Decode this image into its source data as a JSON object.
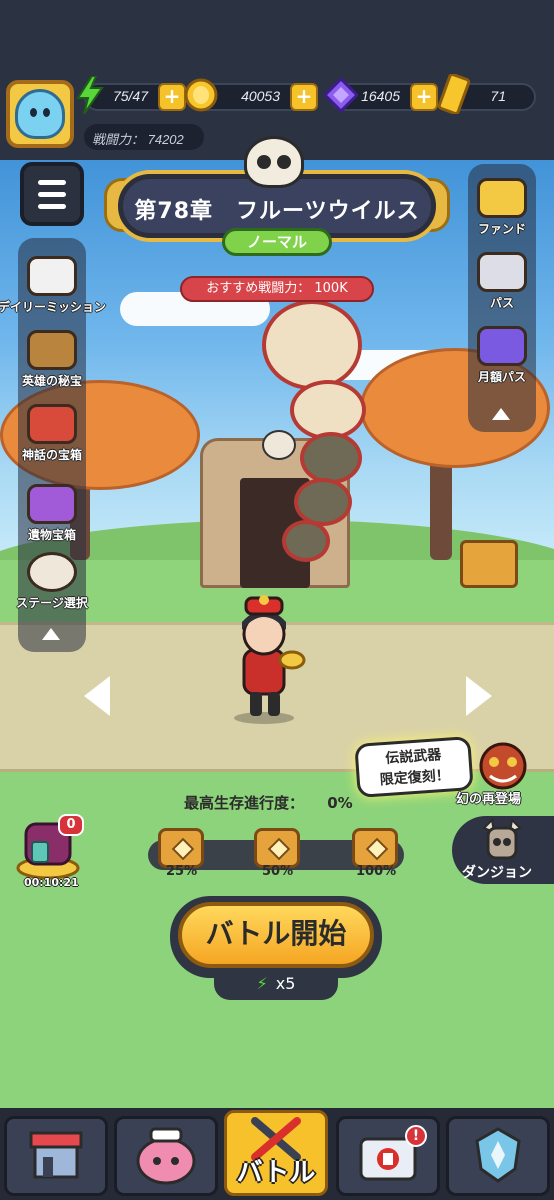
{
  "resources": {
    "stamina": "75/47",
    "gold": "40053",
    "gems": "16405",
    "tickets": "71"
  },
  "power": "戦闘力： 74202",
  "chapter": {
    "title": "第78章　フルーツウイルス",
    "difficulty": "ノーマル",
    "recommended": "おすすめ戦闘力：  100K"
  },
  "left_menu": {
    "items": [
      {
        "label": "デイリーミッション",
        "icon": "calendar-star-icon"
      },
      {
        "label": "英雄の秘宝",
        "icon": "treasure-keys-icon"
      },
      {
        "label": "神話の宝箱",
        "icon": "mythic-chest-icon"
      },
      {
        "label": "遺物宝箱",
        "icon": "relic-chest-icon"
      },
      {
        "label": "ステージ選択",
        "icon": "skull-stage-icon"
      }
    ]
  },
  "right_menu": {
    "items": [
      {
        "label": "ファンド",
        "icon": "piggy-bank-icon"
      },
      {
        "label": "パス",
        "icon": "pass-icon"
      },
      {
        "label": "月額パス",
        "icon": "monthly-card-icon"
      }
    ]
  },
  "progress": {
    "label": "最高生存進行度：",
    "value": "0%",
    "milestones": [
      "25%",
      "50%",
      "100%"
    ]
  },
  "idle": {
    "time": "00:10:21",
    "badge": "0"
  },
  "event": {
    "bubble_line1": "伝説武器",
    "bubble_line2": "限定復刻！",
    "label": "幻の再登場"
  },
  "dungeon": {
    "label": "ダンジョン"
  },
  "battle": {
    "start_label": "バトル開始",
    "cost": "x5"
  },
  "bottom_nav": {
    "battle_label": "バトル",
    "alert": "!"
  },
  "colors": {
    "accent": "#f6c12b",
    "chapter_bg": "#3a4260",
    "difficulty": "#7fd24a",
    "recommend": "#d7454a"
  }
}
